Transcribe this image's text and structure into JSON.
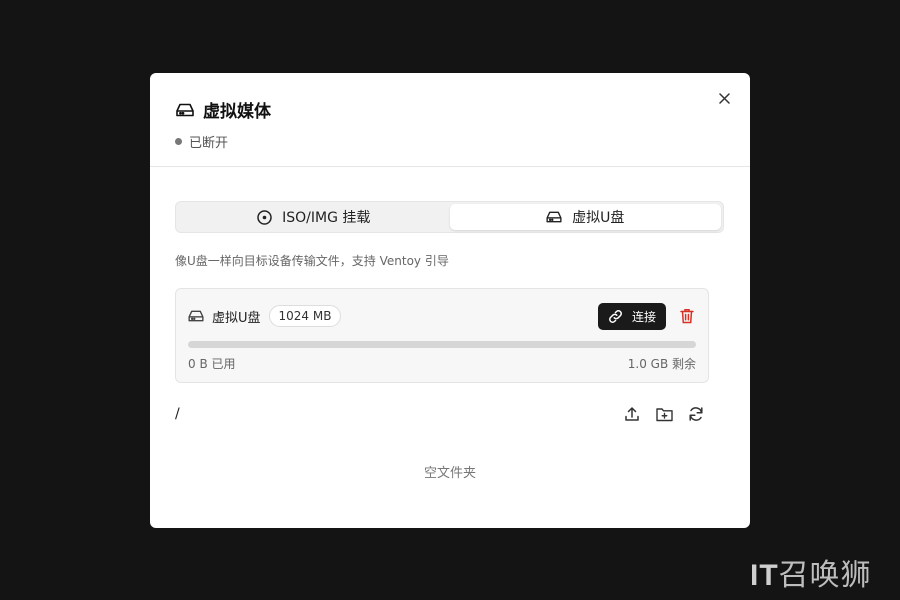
{
  "modal": {
    "title": "虚拟媒体",
    "status": "已断开",
    "close_icon": "close-icon"
  },
  "tabs": [
    {
      "label": "ISO/IMG 挂载",
      "icon": "disc-icon",
      "active": false
    },
    {
      "label": "虚拟U盘",
      "icon": "drive-icon",
      "active": true
    }
  ],
  "description": "像U盘一样向目标设备传输文件，支持 Ventoy 引导",
  "drive": {
    "name": "虚拟U盘",
    "size": "1024 MB",
    "connect_label": "连接",
    "used_label": "0 B 已用",
    "free_label": "1.0 GB 剩余",
    "usage_fraction": 0
  },
  "file_browser": {
    "path": "/",
    "actions": [
      "upload-icon",
      "new-folder-icon",
      "refresh-icon"
    ],
    "empty_text": "空文件夹"
  },
  "watermark": {
    "bold": "IT",
    "rest": "召唤狮"
  },
  "colors": {
    "backdrop": "#141414",
    "danger": "#d93025",
    "primary_button": "#1a1a1a"
  }
}
